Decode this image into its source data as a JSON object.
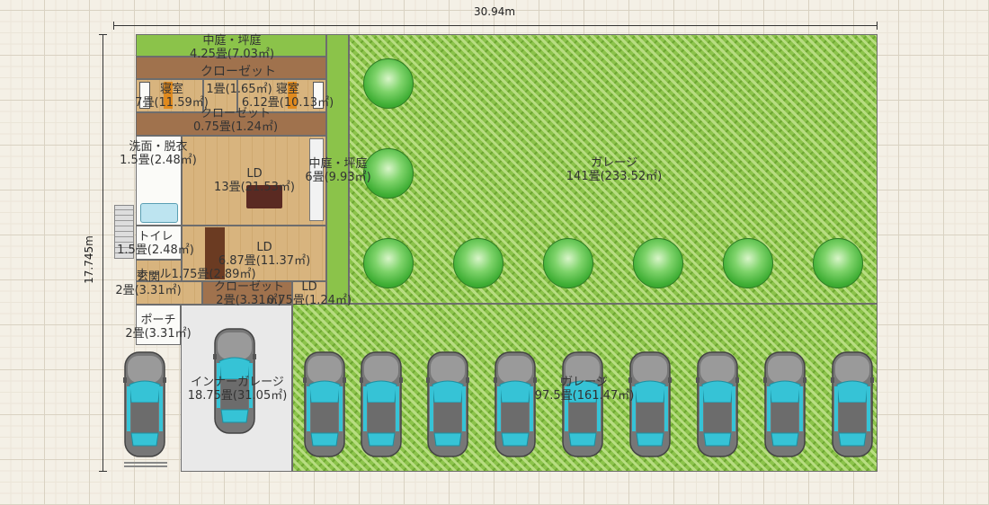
{
  "dimensions": {
    "width_label": "30.94m",
    "height_label": "17.745m"
  },
  "rooms": {
    "courtyard_top": {
      "name": "中庭・坪庭",
      "area": "4.25畳(7.03㎡)"
    },
    "closet_top": {
      "name": "クローゼット"
    },
    "bedroom_left": {
      "name": "寝室",
      "area": "7畳(11.59㎡)"
    },
    "bedroom_mid": {
      "name": "1畳(1.65㎡)"
    },
    "bedroom_right": {
      "name": "寝室",
      "area": "6.12畳(10.13㎡)"
    },
    "closet_mid": {
      "name": "クローゼット",
      "area": "0.75畳(1.24㎡)"
    },
    "washroom": {
      "name": "洗面・脱衣",
      "area": "1.5畳(2.48㎡)"
    },
    "ld_main": {
      "name": "LD",
      "area": "13畳(21.53㎡)"
    },
    "courtyard_mid": {
      "name": "中庭・坪庭",
      "area": "6畳(9.93㎡)"
    },
    "garage_big": {
      "name": "ガレージ",
      "area": "141畳(233.52㎡)"
    },
    "toilet": {
      "name": "トイレ",
      "area": "1.5畳(2.48㎡)"
    },
    "ld_second": {
      "name": "LD",
      "area": "6.87畳(11.37㎡)"
    },
    "hall": {
      "name": "ホール",
      "area": "1.75畳(2.89㎡)"
    },
    "entrance": {
      "name": "玄関",
      "area": "2畳(3.31㎡)"
    },
    "closet_low": {
      "name": "クローゼット",
      "area": "2畳(3.31㎡)"
    },
    "ld_small": {
      "name": "LD",
      "area": "0.75畳(1.24㎡)"
    },
    "porch": {
      "name": "ポーチ",
      "area": "2畳(3.31㎡)"
    },
    "inner_garage": {
      "name": "インナーガレージ",
      "area": "18.75畳(31.05㎡)"
    },
    "garage_low": {
      "name": "ガレージ",
      "area": "97.5畳(161.47㎡)"
    }
  },
  "colors": {
    "lawn": "#8bc34a",
    "floor": "#d8b47e",
    "closet": "#a0724d",
    "car_glass": "#36c3d6"
  }
}
